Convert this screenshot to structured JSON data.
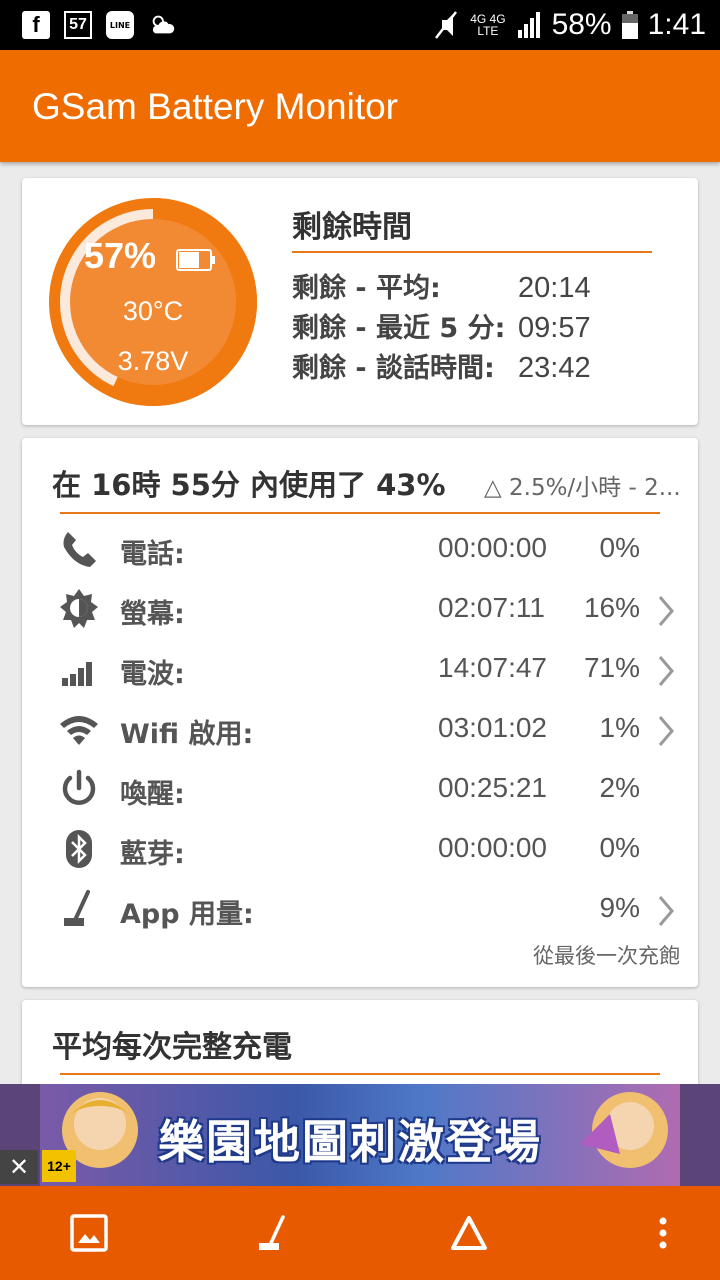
{
  "status_bar": {
    "notif_fb": "f",
    "notif_57": "57",
    "notif_line": "LINE",
    "network_top": "4G 4G",
    "network_bottom": "LTE",
    "battery_percent": "58%",
    "time": "1:41"
  },
  "app_bar": {
    "title": "GSam Battery Monitor"
  },
  "gauge": {
    "percent": "57%",
    "level": 0.57,
    "temperature": "30°C",
    "voltage": "3.78V"
  },
  "remaining": {
    "title": "剩餘時間",
    "rows": [
      {
        "label": "剩餘 - 平均:",
        "value": "20:14"
      },
      {
        "label": "剩餘 - 最近 5 分:",
        "value": "09:57"
      },
      {
        "label": "剩餘 - 談話時間:",
        "value": "23:42"
      }
    ]
  },
  "usage": {
    "title": "在 16時 55分 內使用了 43%",
    "delta": "△ 2.5%/小時 - 2...",
    "rows": [
      {
        "icon": "phone-icon",
        "label": "電話:",
        "time": "00:00:00",
        "percent": "0%",
        "chevron": false
      },
      {
        "icon": "screen-brightness-icon",
        "label": "螢幕:",
        "time": "02:07:11",
        "percent": "16%",
        "chevron": true
      },
      {
        "icon": "signal-bars-icon",
        "label": "電波:",
        "time": "14:07:47",
        "percent": "71%",
        "chevron": true
      },
      {
        "icon": "wifi-icon",
        "label": "Wifi 啟用:",
        "time": "03:01:02",
        "percent": "1%",
        "chevron": true
      },
      {
        "icon": "power-icon",
        "label": "喚醒:",
        "time": "00:25:21",
        "percent": "2%",
        "chevron": false
      },
      {
        "icon": "bluetooth-icon",
        "label": "藍芽:",
        "time": "00:00:00",
        "percent": "0%",
        "chevron": false
      },
      {
        "icon": "app-broom-icon",
        "label": "App 用量:",
        "time": "",
        "percent": "9%",
        "chevron": true
      }
    ],
    "since_note": "從最後一次充飽"
  },
  "average": {
    "title": "平均每次完整充電"
  },
  "ad": {
    "text": "樂園地圖刺激登場",
    "rating": "12+",
    "close": "✕"
  },
  "colors": {
    "accent": "#ef6c00",
    "bottom_bar": "#e85a00"
  }
}
